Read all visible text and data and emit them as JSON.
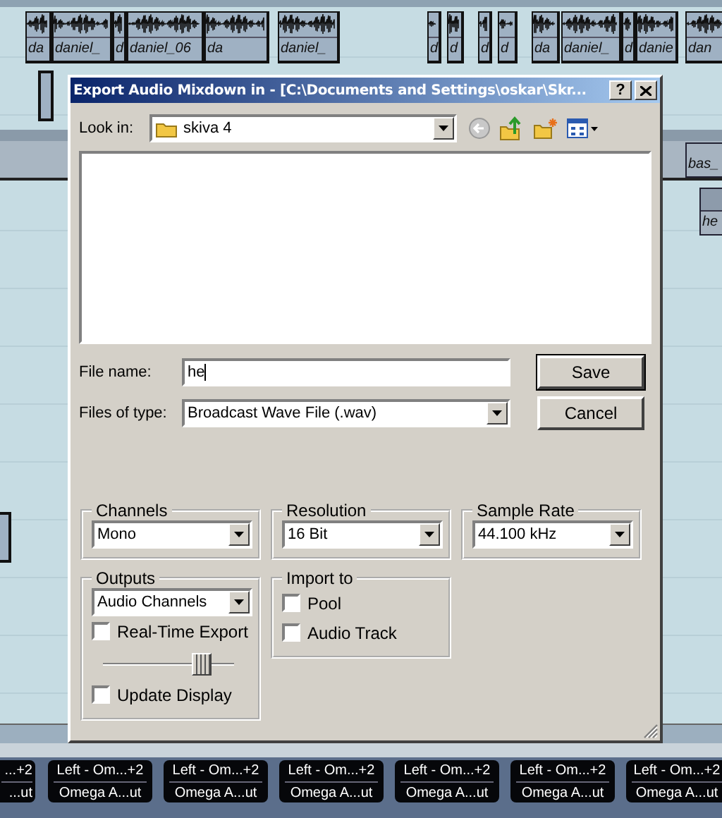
{
  "arrangement": {
    "clips": [
      {
        "label": "da"
      },
      {
        "label": "daniel_"
      },
      {
        "label": "d"
      },
      {
        "label": "daniel_06"
      },
      {
        "label": "da"
      },
      {
        "label": "daniel_"
      },
      {
        "label": "d"
      },
      {
        "label": "d"
      },
      {
        "label": "d"
      },
      {
        "label": "d"
      },
      {
        "label": "da"
      },
      {
        "label": "daniel_"
      },
      {
        "label": "d"
      },
      {
        "label": "danie"
      },
      {
        "label": "dan"
      }
    ],
    "side_clips": [
      {
        "label": "bas_"
      },
      {
        "label": "he"
      }
    ]
  },
  "dialog": {
    "title": "Export Audio Mixdown in - [C:\\Documents and Settings\\oskar\\Skr...",
    "help_button": "?",
    "look_in": {
      "label": "Look in:",
      "value": "skiva 4"
    },
    "file_name": {
      "label": "File name:",
      "value": "he"
    },
    "file_type": {
      "label": "Files of type:",
      "value": "Broadcast Wave File (.wav)"
    },
    "buttons": [
      "Save",
      "Cancel"
    ],
    "channels": {
      "title": "Channels",
      "value": "Mono"
    },
    "resolution": {
      "title": "Resolution",
      "value": "16 Bit"
    },
    "sample_rate": {
      "title": "Sample Rate",
      "value": "44.100 kHz"
    },
    "outputs": {
      "title": "Outputs",
      "value": "Audio Channels",
      "real_time_export": {
        "label": "Real-Time Export",
        "checked": false
      },
      "slider": {
        "level": 0.8
      },
      "update_display": {
        "label": "Update Display",
        "checked": false
      }
    },
    "import_to": {
      "title": "Import to",
      "options": [
        {
          "label": "Pool",
          "checked": false
        },
        {
          "label": "Audio Track",
          "checked": false
        }
      ]
    }
  },
  "mixer": {
    "strips": [
      {
        "output": "...+2",
        "input": "...ut"
      },
      {
        "output": "Left - Om...+2",
        "input": "Omega A...ut"
      },
      {
        "output": "Left - Om...+2",
        "input": "Omega A...ut"
      },
      {
        "output": "Left - Om...+2",
        "input": "Omega A...ut"
      },
      {
        "output": "Left - Om...+2",
        "input": "Omega A...ut"
      },
      {
        "output": "Left - Om...+2",
        "input": "Omega A...ut"
      },
      {
        "output": "Left - Om...+2",
        "input": "Omega A...ut"
      }
    ]
  }
}
